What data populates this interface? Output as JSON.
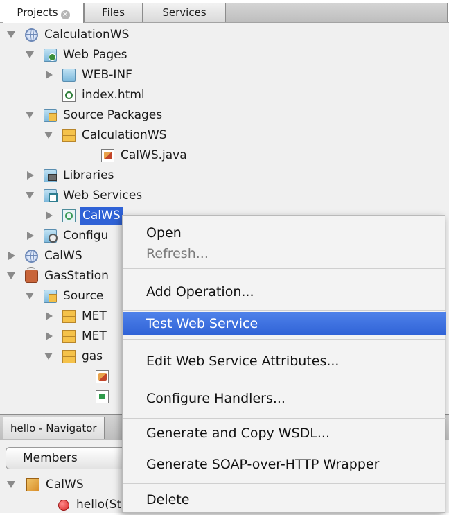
{
  "tabs": [
    {
      "label": "Projects",
      "active": true,
      "closable": true
    },
    {
      "label": "Files",
      "active": false
    },
    {
      "label": "Services",
      "active": false
    }
  ],
  "tree": [
    {
      "label": "CalculationWS",
      "icon": "globe-icon",
      "expanded": true
    },
    {
      "label": "Web Pages",
      "icon": "web-pages-folder-icon",
      "expanded": true
    },
    {
      "label": "WEB-INF",
      "icon": "folder-icon",
      "expanded": false
    },
    {
      "label": "index.html",
      "icon": "html-file-icon"
    },
    {
      "label": "Source Packages",
      "icon": "source-packages-folder-icon",
      "expanded": true
    },
    {
      "label": "CalculationWS",
      "icon": "package-icon",
      "expanded": true
    },
    {
      "label": "CalWS.java",
      "icon": "java-file-icon"
    },
    {
      "label": "Libraries",
      "icon": "libraries-folder-icon",
      "expanded": false
    },
    {
      "label": "Web Services",
      "icon": "web-services-folder-icon",
      "expanded": true
    },
    {
      "label": "CalWS",
      "icon": "web-service-icon",
      "expanded": false,
      "selected": true
    },
    {
      "label": "Configu",
      "icon": "configuration-folder-icon",
      "expanded": false
    },
    {
      "label": "CalWS",
      "icon": "globe-icon",
      "expanded": false
    },
    {
      "label": "GasStation",
      "icon": "coffee-project-icon",
      "expanded": true
    },
    {
      "label": "Source",
      "icon": "source-packages-folder-icon",
      "expanded": true
    },
    {
      "label": "MET",
      "icon": "package-icon",
      "expanded": false
    },
    {
      "label": "MET",
      "icon": "package-icon",
      "expanded": false
    },
    {
      "label": "gas",
      "icon": "package-icon",
      "expanded": true
    },
    {
      "label": "",
      "icon": "java-file-icon"
    },
    {
      "label": "",
      "icon": "form-file-icon"
    }
  ],
  "navigator": {
    "title": "hello - Navigator",
    "filter": "Members",
    "class_label": "CalWS",
    "method_label": "hello(St"
  },
  "context_menu": [
    {
      "label": "Open",
      "enabled": true
    },
    {
      "label": "Refresh...",
      "enabled": false
    },
    {
      "label": "Add Operation...",
      "enabled": true
    },
    {
      "label": "Test Web Service",
      "enabled": true,
      "highlighted": true
    },
    {
      "label": "Edit Web Service Attributes...",
      "enabled": true
    },
    {
      "label": "Configure Handlers...",
      "enabled": true
    },
    {
      "label": "Generate and Copy WSDL...",
      "enabled": true
    },
    {
      "label": "Generate SOAP-over-HTTP Wrapper",
      "enabled": true
    },
    {
      "label": "Delete",
      "enabled": true
    }
  ],
  "colors": {
    "selection": "#2f62d6",
    "menu_highlight": "#3b6fe0",
    "panel_bg": "#f0f0f0"
  }
}
